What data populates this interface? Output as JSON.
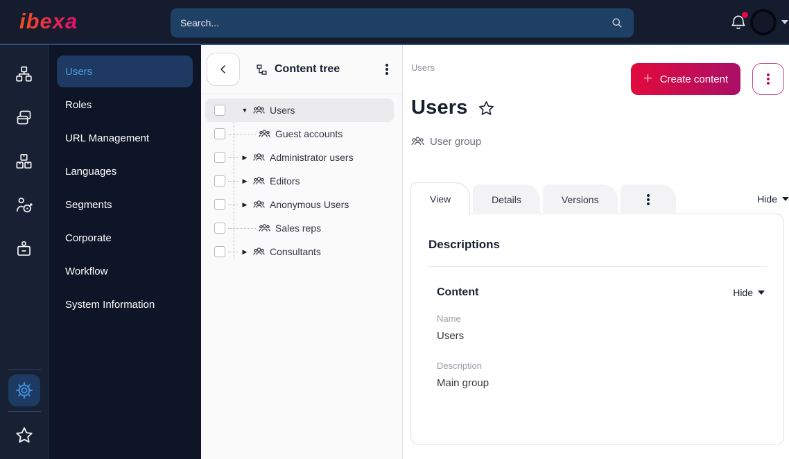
{
  "topbar": {
    "logo_text": "ibexa",
    "search_placeholder": "Search..."
  },
  "rail": {
    "items": [
      {
        "icon": "sitemap-icon"
      },
      {
        "icon": "content-cards-icon"
      },
      {
        "icon": "packages-icon"
      },
      {
        "icon": "personalization-target-icon"
      },
      {
        "icon": "id-badge-icon"
      },
      {
        "icon": "settings-gear-icon",
        "active": true
      },
      {
        "icon": "bookmarks-star-icon"
      }
    ]
  },
  "sidebar": {
    "items": [
      {
        "label": "Users",
        "selected": true
      },
      {
        "label": "Roles"
      },
      {
        "label": "URL Management"
      },
      {
        "label": "Languages"
      },
      {
        "label": "Segments"
      },
      {
        "label": "Corporate"
      },
      {
        "label": "Workflow"
      },
      {
        "label": "System Information"
      }
    ]
  },
  "content_tree": {
    "title": "Content tree",
    "items": [
      {
        "label": "Users",
        "expand": "expanded",
        "selected": true
      },
      {
        "label": "Guest accounts",
        "expand": "none"
      },
      {
        "label": "Administrator users",
        "expand": "collapsed"
      },
      {
        "label": "Editors",
        "expand": "collapsed"
      },
      {
        "label": "Anonymous Users",
        "expand": "collapsed"
      },
      {
        "label": "Sales reps",
        "expand": "none"
      },
      {
        "label": "Consultants",
        "expand": "collapsed"
      }
    ]
  },
  "main": {
    "breadcrumb": "Users",
    "create_button_label": "Create content",
    "title": "Users",
    "content_type": "User group",
    "tabs": [
      {
        "label": "View",
        "active": true
      },
      {
        "label": "Details"
      },
      {
        "label": "Versions"
      }
    ],
    "tabs_hide_label": "Hide",
    "card": {
      "section_title": "Descriptions",
      "subsection_title": "Content",
      "subsection_hide_label": "Hide",
      "fields": [
        {
          "label": "Name",
          "value": "Users"
        },
        {
          "label": "Description",
          "value": "Main group"
        }
      ]
    }
  },
  "colors": {
    "brand_red": "#e20a3c",
    "brand_magenta": "#aa0f67",
    "topbar_bg": "#151c2e",
    "rail_bg": "#182133",
    "menu_bg": "#0d1526",
    "accent_blue": "#4e9be4",
    "selected_item_bg": "#1e3a62",
    "notification_dot": "#e8073f",
    "accent_line": "#2e5380"
  }
}
